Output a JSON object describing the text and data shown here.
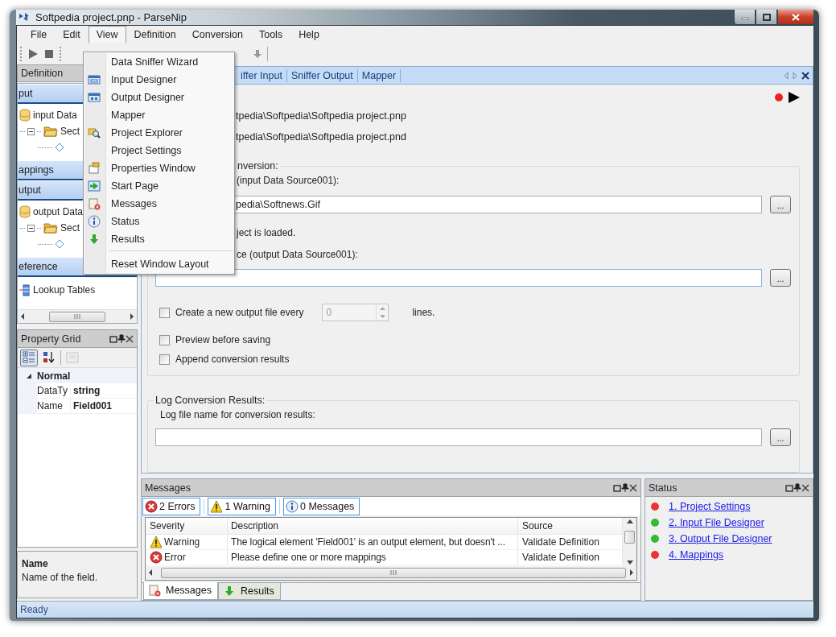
{
  "window": {
    "title": "Softpedia project.pnp - ParseNip"
  },
  "menu_bar": [
    {
      "label": "File",
      "selected": false
    },
    {
      "label": "Edit",
      "selected": false
    },
    {
      "label": "View",
      "selected": true
    },
    {
      "label": "Definition",
      "selected": false
    },
    {
      "label": "Conversion",
      "selected": false
    },
    {
      "label": "Tools",
      "selected": false
    },
    {
      "label": "Help",
      "selected": false
    }
  ],
  "view_menu": [
    {
      "kind": "item",
      "label": "Data Sniffer Wizard"
    },
    {
      "kind": "item",
      "label": "Input Designer"
    },
    {
      "kind": "item",
      "label": "Output Designer"
    },
    {
      "kind": "item",
      "label": "Mapper"
    },
    {
      "kind": "item",
      "label": "Project Explorer"
    },
    {
      "kind": "item",
      "label": "Project Settings"
    },
    {
      "kind": "item",
      "label": "Properties Window"
    },
    {
      "kind": "item",
      "label": "Start Page"
    },
    {
      "kind": "item",
      "label": "Messages"
    },
    {
      "kind": "item",
      "label": "Status"
    },
    {
      "kind": "item",
      "label": "Results"
    },
    {
      "kind": "separator"
    },
    {
      "kind": "item",
      "label": "Reset Window Layout"
    }
  ],
  "definition_panel": {
    "title": "Definition",
    "sections": [
      {
        "kind": "tree",
        "title": "put",
        "tree": [
          {
            "kind": "source",
            "label": "input Data",
            "children": [
              {
                "kind": "section",
                "label": "Sect",
                "expanded": true,
                "children": [
                  {
                    "kind": "element"
                  }
                ]
              }
            ]
          }
        ]
      },
      {
        "kind": "empty",
        "title": "appings"
      },
      {
        "kind": "tree",
        "title": "utput",
        "tree": [
          {
            "kind": "source",
            "label": "output Data",
            "children": [
              {
                "kind": "section",
                "label": "Sect",
                "expanded": true,
                "children": [
                  {
                    "kind": "element"
                  }
                ]
              }
            ]
          }
        ]
      },
      {
        "kind": "list",
        "title": "eference",
        "items": [
          {
            "label": "Lookup Tables"
          }
        ]
      }
    ]
  },
  "property_grid": {
    "title": "Property Grid",
    "toolbar": [
      {
        "kind": "categorized",
        "selected": true
      },
      {
        "kind": "alphabetical",
        "selected": false
      },
      {
        "kind": "pages",
        "selected": false
      }
    ],
    "categories": [
      {
        "name": "Normal",
        "expanded": true,
        "properties": [
          {
            "name": "DataTy",
            "value": "string"
          },
          {
            "name": "Name",
            "value": "Field001"
          }
        ]
      }
    ],
    "help": {
      "title": "Name",
      "text": "Name of the field."
    }
  },
  "document": {
    "tabs": [
      {
        "label": "iffer Input"
      },
      {
        "label": "Sniffer Output"
      },
      {
        "label": "Mapper"
      }
    ],
    "project_path": "tpedia\\Softpedia\\Softpedia project.pnp",
    "definition_path": "tpedia\\Softpedia\\Softpedia project.pnd",
    "conversion": {
      "title": "nversion:",
      "input_label": "(input Data Source001):",
      "input_value": "pedia\\Softnews.Gif",
      "browse": "...",
      "loaded_text": "ject is loaded.",
      "output_label": "ce (output Data Source001):",
      "output_browse": "...",
      "options": [
        {
          "kind": "split",
          "label": "Create a new output file every",
          "checked": false,
          "value": "0",
          "disabled": true,
          "suffix": "lines."
        },
        {
          "kind": "check",
          "label": "Preview before saving",
          "checked": false
        },
        {
          "kind": "check",
          "label": "Append conversion  results",
          "checked": false
        }
      ]
    },
    "log": {
      "title": "Log Conversion Results:",
      "label": "Log file name for conversion results:",
      "browse": "..."
    }
  },
  "messages_panel": {
    "title": "Messages",
    "filters": [
      {
        "kind": "error",
        "label": "2 Errors",
        "selected": true
      },
      {
        "kind": "warning",
        "label": "1 Warning",
        "selected": true
      },
      {
        "kind": "info",
        "label": "0 Messages",
        "selected": true
      }
    ],
    "columns": [
      "Severity",
      "Description",
      "Source"
    ],
    "rows": [
      {
        "kind": "warning",
        "severity": "Warning",
        "description": "The logical element 'Field001' is an output element, but doesn't ...",
        "source": "Validate Definition"
      },
      {
        "kind": "error",
        "severity": "Error",
        "description": "Please define one or more mappings",
        "source": "Validate Definition"
      }
    ],
    "tabs": [
      {
        "kind": "messages",
        "label": "Messages",
        "selected": true
      },
      {
        "kind": "results",
        "label": "Results",
        "selected": false
      }
    ]
  },
  "status_panel": {
    "title": "Status",
    "items": [
      {
        "label": "1. Project Settings",
        "color": "#ee3333"
      },
      {
        "label": "2. Input File Designer",
        "color": "#33bb33"
      },
      {
        "label": "3. Output File Designer",
        "color": "#33bb33"
      },
      {
        "label": "4. Mappings",
        "color": "#ee3333"
      }
    ]
  },
  "status_bar": {
    "text": "Ready"
  }
}
